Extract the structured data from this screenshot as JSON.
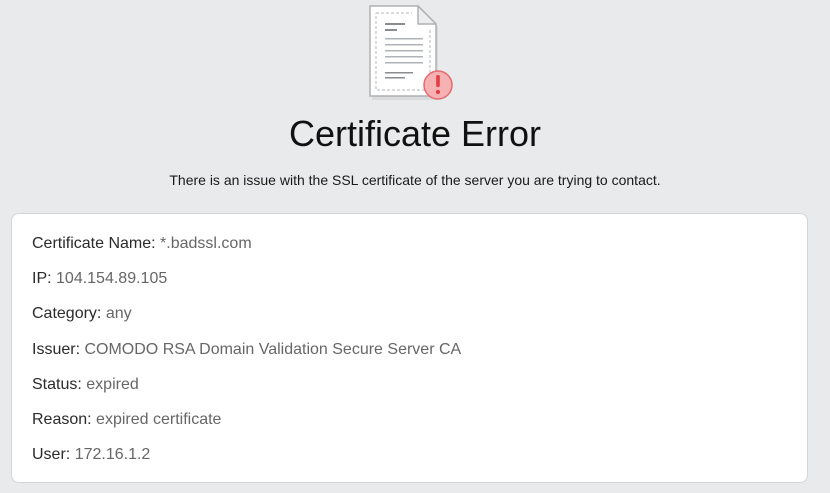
{
  "page": {
    "title": "Certificate Error",
    "message": "There is an issue with the SSL certificate of the server you are trying to contact."
  },
  "details": [
    {
      "label": "Certificate Name:",
      "value": "*.badssl.com"
    },
    {
      "label": "IP:",
      "value": "104.154.89.105"
    },
    {
      "label": "Category:",
      "value": "any"
    },
    {
      "label": "Issuer:",
      "value": "COMODO RSA Domain Validation Secure Server CA"
    },
    {
      "label": "Status:",
      "value": "expired"
    },
    {
      "label": "Reason:",
      "value": "expired certificate"
    },
    {
      "label": "User:",
      "value": "172.16.1.2"
    }
  ],
  "icons": {
    "header": "document-error-icon"
  },
  "colors": {
    "background": "#e8eaeb",
    "card": "#ffffff",
    "error_badge": "#f4a7a7",
    "error_mark": "#e8434a"
  }
}
